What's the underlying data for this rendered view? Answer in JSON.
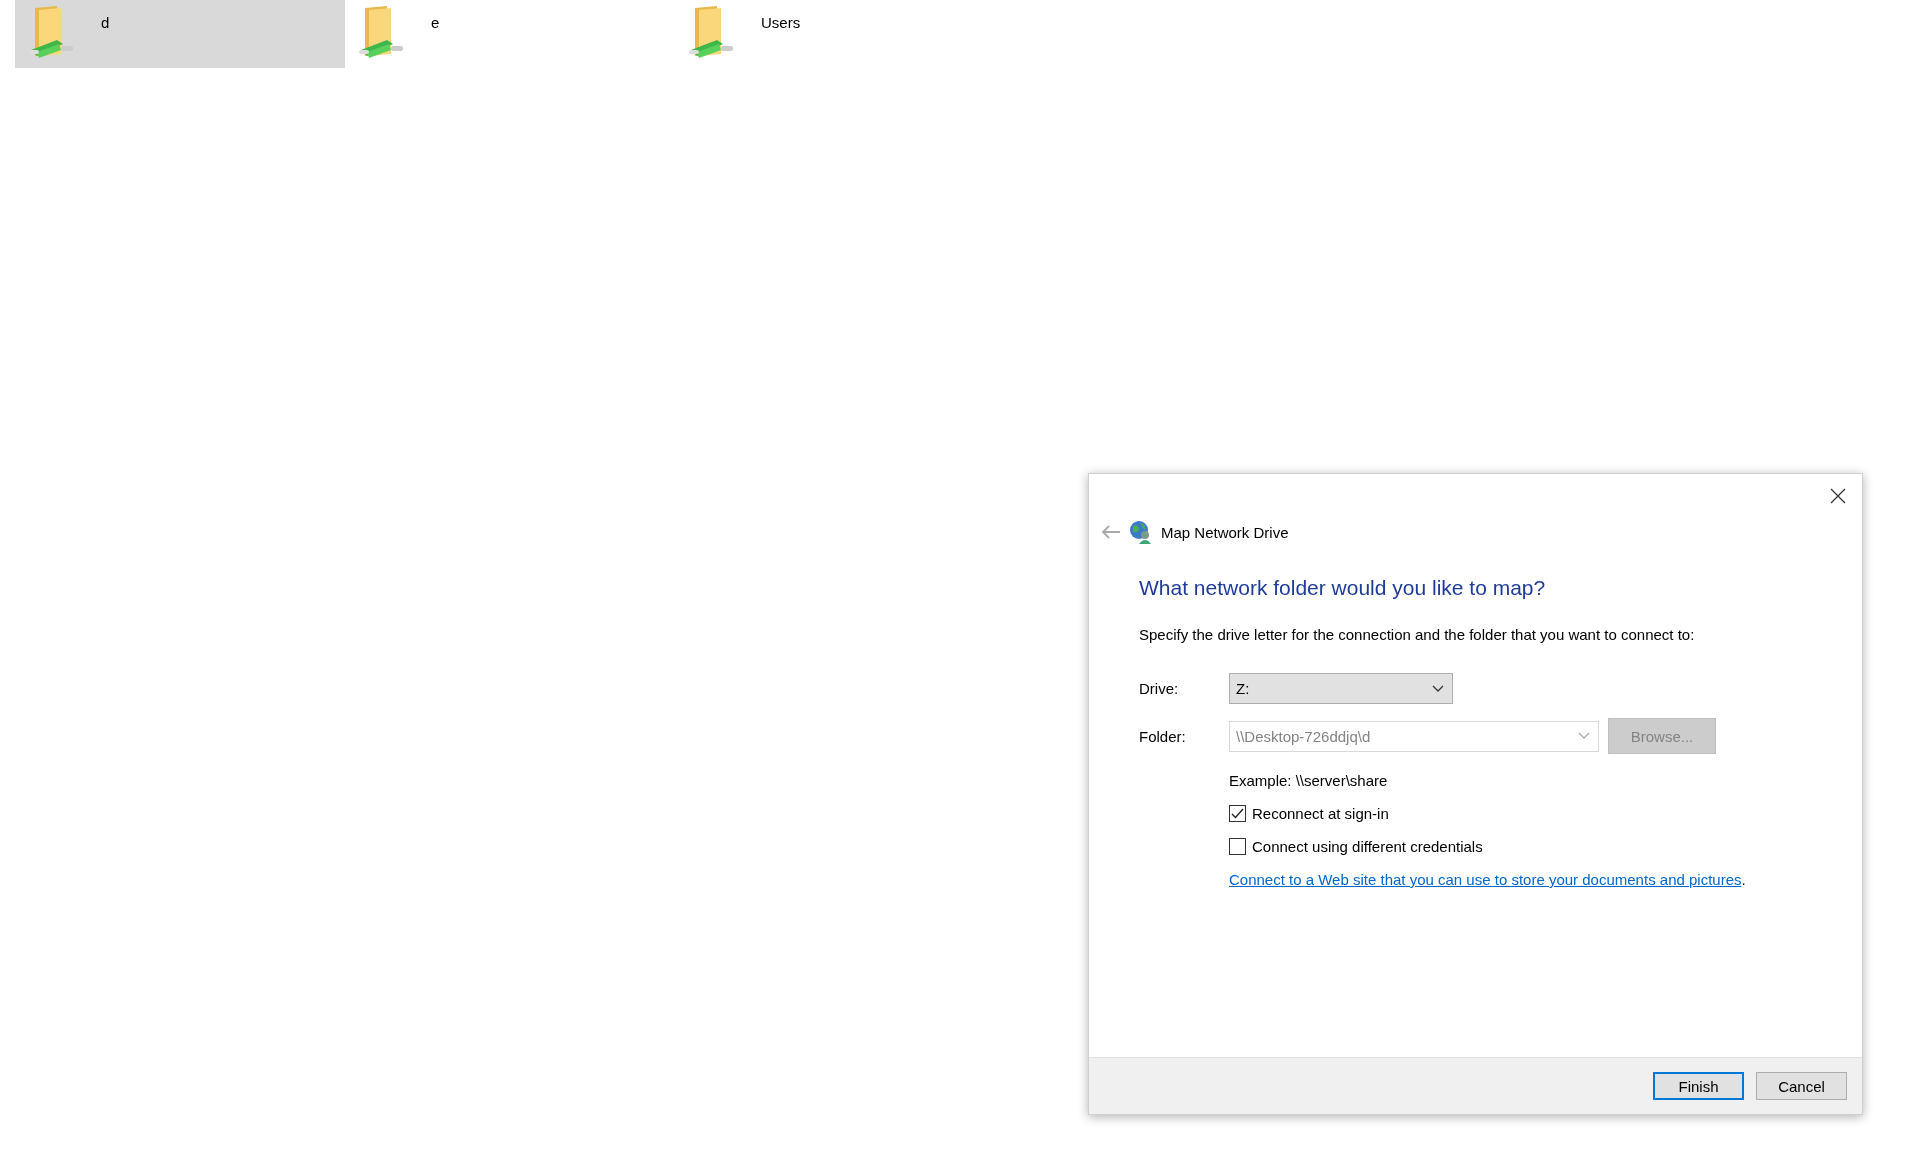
{
  "folders": [
    {
      "name": "d",
      "selected": true
    },
    {
      "name": "e",
      "selected": false
    },
    {
      "name": "Users",
      "selected": false
    }
  ],
  "dialog": {
    "title": "Map Network Drive",
    "heading": "What network folder would you like to map?",
    "description": "Specify the drive letter for the connection and the folder that you want to connect to:",
    "drive": {
      "label": "Drive:",
      "value": "Z:",
      "disabled": false
    },
    "folder": {
      "label": "Folder:",
      "value": "\\\\Desktop-726ddjq\\d",
      "disabled": true
    },
    "browse": {
      "label": "Browse...",
      "disabled": true
    },
    "example": "Example: \\\\server\\share",
    "options": [
      {
        "label": "Reconnect at sign-in",
        "checked": true
      },
      {
        "label": "Connect using different credentials",
        "checked": false
      }
    ],
    "link": {
      "text": "Connect to a Web site that you can use to store your documents and pictures",
      "after": "."
    },
    "buttons": [
      {
        "label": "Finish",
        "default": true
      },
      {
        "label": "Cancel",
        "default": false
      }
    ]
  }
}
